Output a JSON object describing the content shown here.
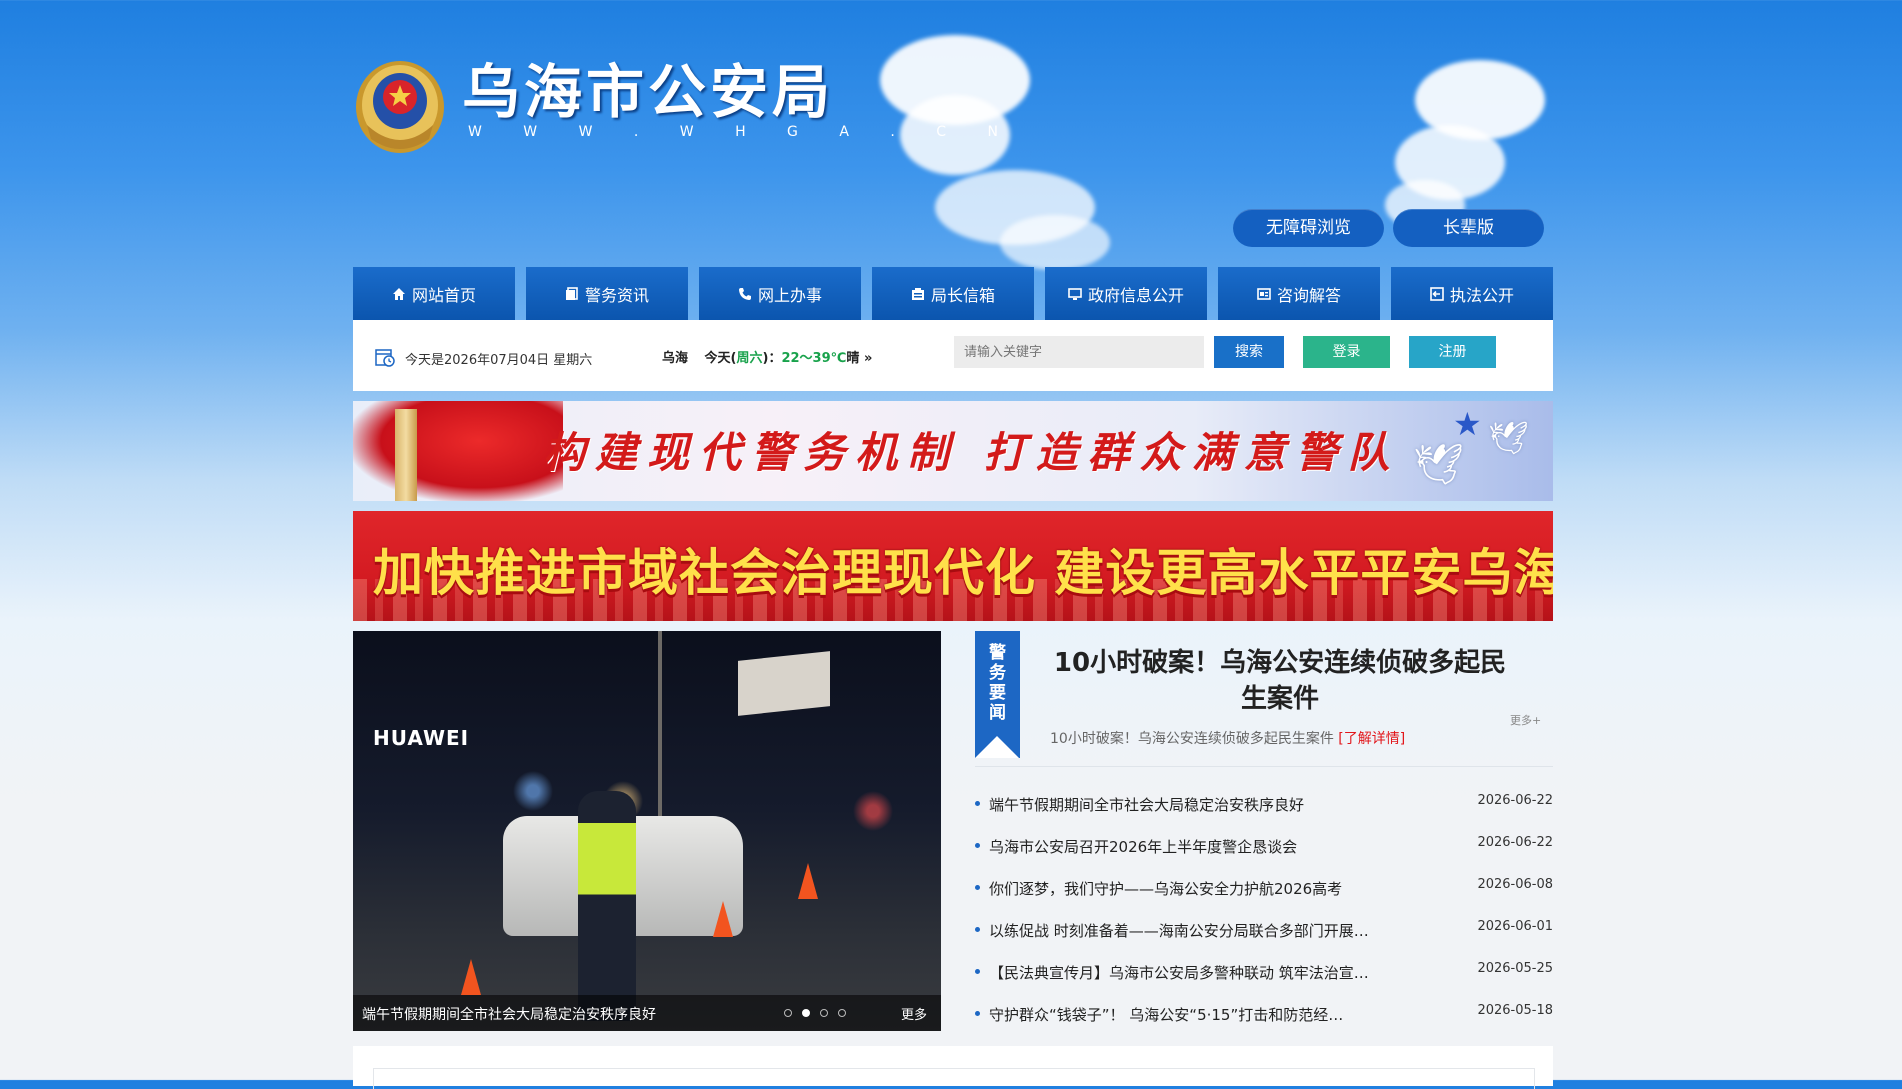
{
  "header": {
    "title": "乌海市公安局",
    "subtitle": "W W W . W H G A . C N",
    "accessibility_label": "无障碍浏览",
    "elder_label": "长辈版"
  },
  "nav": {
    "items": [
      {
        "label": "网站首页",
        "icon": "home-icon"
      },
      {
        "label": "警务资讯",
        "icon": "document-icon"
      },
      {
        "label": "网上办事",
        "icon": "phone-icon"
      },
      {
        "label": "局长信箱",
        "icon": "mailbox-icon"
      },
      {
        "label": "政府信息公开",
        "icon": "monitor-icon"
      },
      {
        "label": "咨询解答",
        "icon": "card-icon"
      },
      {
        "label": "执法公开",
        "icon": "exit-icon"
      }
    ]
  },
  "infobar": {
    "date_text": "今天是2026年07月04日  星期六",
    "weather": {
      "city": "乌海",
      "prefix": "今天(",
      "weekday": "周六",
      "suffix": ")：",
      "temp": "22～39℃",
      "condition": "晴",
      "arrow": "»"
    },
    "search_placeholder": "请输入关键字",
    "search_label": "搜索",
    "login_label": "登录",
    "register_label": "注册"
  },
  "banners": {
    "banner1_text": "构建现代警务机制   打造群众满意警队",
    "banner2_text": "加快推进市域社会治理现代化  建设更高水平平安乌海"
  },
  "slider": {
    "brand_text": "HUAWEI",
    "caption": "端午节假期期间全市社会大局稳定治安秩序良好",
    "more_label": "更多",
    "dot_count": 4,
    "active_dot": 2
  },
  "news": {
    "tag": [
      "警",
      "务",
      "要",
      "闻"
    ],
    "headline": "10小时破案！乌海公安连续侦破多起民生案件",
    "headline_summary": "10小时破案！乌海公安连续侦破多起民生案件",
    "detail_link": "[了解详情]",
    "more_label": "更多+",
    "items": [
      {
        "title": "端午节假期期间全市社会大局稳定治安秩序良好",
        "date": "2026-06-22"
      },
      {
        "title": "乌海市公安局召开2026年上半年度警企恳谈会",
        "date": "2026-06-22"
      },
      {
        "title": "你们逐梦，我们守护——乌海公安全力护航2026高考",
        "date": "2026-06-08"
      },
      {
        "title": "以练促战 时刻准备着——海南公安分局联合多部门开展…",
        "date": "2026-06-01"
      },
      {
        "title": "【民法典宣传月】乌海市公安局多警种联动 筑牢法治宣…",
        "date": "2026-05-25"
      },
      {
        "title": "守护群众“钱袋子”！ 乌海公安“5·15”打击和防范经…",
        "date": "2026-05-18"
      }
    ]
  },
  "colors": {
    "nav_blue": "#0e5db9",
    "search_blue": "#1970c8",
    "login_green": "#2bb48b",
    "register_teal": "#27a5c8",
    "accent_red": "#e2161b"
  }
}
